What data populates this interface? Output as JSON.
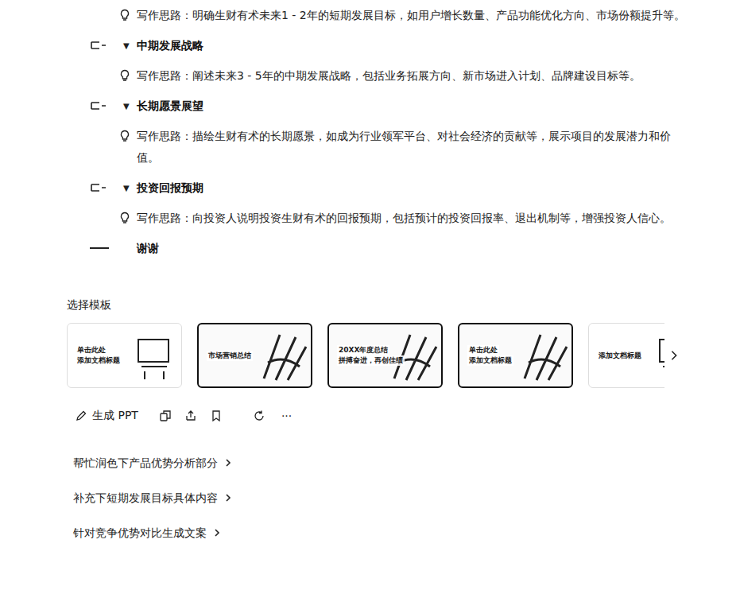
{
  "outline": [
    {
      "kind": "idea",
      "text": "写作思路：明确生财有术未来1 - 2年的短期发展目标，如用户增长数量、产品功能优化方向、市场份额提升等。"
    },
    {
      "kind": "section",
      "toggle": "▼",
      "text": "中期发展战略"
    },
    {
      "kind": "idea",
      "text": "写作思路：阐述未来3 - 5年的中期发展战略，包括业务拓展方向、新市场进入计划、品牌建设目标等。"
    },
    {
      "kind": "section",
      "toggle": "▼",
      "text": "长期愿景展望"
    },
    {
      "kind": "idea",
      "text": "写作思路：描绘生财有术的长期愿景，如成为行业领军平台、对社会经济的贡献等，展示项目的发展潜力和价值。"
    },
    {
      "kind": "section",
      "toggle": "▼",
      "text": "投资回报预期"
    },
    {
      "kind": "idea",
      "text": "写作思路：向投资人说明投资生财有术的回报预期，包括预计的投资回报率、退出机制等，增强投资人信心。"
    },
    {
      "kind": "ending",
      "text": "谢谢"
    }
  ],
  "templates_label": "选择模板",
  "templates": [
    {
      "kind": "plain",
      "selected": false,
      "lines": [
        "单击此处",
        "添加文档标题"
      ]
    },
    {
      "kind": "outlined",
      "selected": false,
      "lines": [
        "市场营销总结"
      ]
    },
    {
      "kind": "outlined",
      "selected": false,
      "lines": [
        "20XX年度总结",
        "拼搏奋进，再创佳绩"
      ]
    },
    {
      "kind": "outlined",
      "selected": false,
      "lines": [
        "单击此处",
        "添加文档标题"
      ]
    },
    {
      "kind": "plain",
      "selected": false,
      "lines": [
        "添加文档标题"
      ]
    }
  ],
  "actions": {
    "generate": "生成 PPT",
    "more": "···"
  },
  "suggestions": [
    "帮忙润色下产品优势分析部分",
    "补充下短期发展目标具体内容",
    "针对竞争优势对比生成文案"
  ]
}
